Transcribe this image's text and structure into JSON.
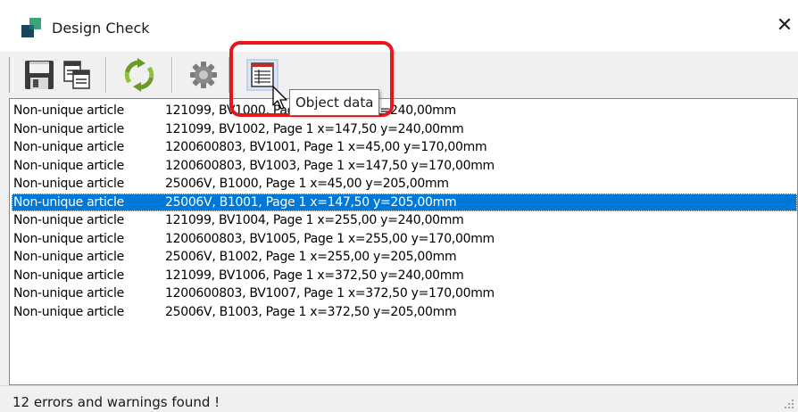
{
  "window": {
    "title": "Design Check",
    "close_glyph": "✕"
  },
  "toolbar": {
    "buttons": [
      {
        "icon": "save-icon"
      },
      {
        "icon": "copy-icon"
      },
      {
        "icon": "refresh-icon"
      },
      {
        "icon": "settings-icon"
      },
      {
        "icon": "object-data-icon"
      }
    ],
    "tooltip": "Object data"
  },
  "list": {
    "selected_index": 5,
    "rows": [
      {
        "type": "Non-unique article",
        "detail": "121099, BV1000, Page 1 x=45,00 y=240,00mm"
      },
      {
        "type": "Non-unique article",
        "detail": "121099, BV1002, Page 1 x=147,50 y=240,00mm"
      },
      {
        "type": "Non-unique article",
        "detail": "1200600803, BV1001, Page 1 x=45,00 y=170,00mm"
      },
      {
        "type": "Non-unique article",
        "detail": "1200600803, BV1003, Page 1 x=147,50 y=170,00mm"
      },
      {
        "type": "Non-unique article",
        "detail": "25006V, B1000, Page 1 x=45,00 y=205,00mm"
      },
      {
        "type": "Non-unique article",
        "detail": "25006V, B1001, Page 1 x=147,50 y=205,00mm"
      },
      {
        "type": "Non-unique article",
        "detail": "121099, BV1004, Page 1 x=255,00 y=240,00mm"
      },
      {
        "type": "Non-unique article",
        "detail": "1200600803, BV1005, Page 1 x=255,00 y=170,00mm"
      },
      {
        "type": "Non-unique article",
        "detail": "25006V, B1002, Page 1 x=255,00 y=205,00mm"
      },
      {
        "type": "Non-unique article",
        "detail": "121099, BV1006, Page 1 x=372,50 y=240,00mm"
      },
      {
        "type": "Non-unique article",
        "detail": "1200600803, BV1007, Page 1 x=372,50 y=170,00mm"
      },
      {
        "type": "Non-unique article",
        "detail": "25006V, B1003, Page 1 x=372,50 y=205,00mm"
      }
    ]
  },
  "status": {
    "text": "12 errors and warnings found !"
  },
  "colors": {
    "selection": "#0078d7",
    "highlight_ring": "#e8161b",
    "app_icon_dark": "#17475f",
    "app_icon_green": "#3aa57a"
  }
}
